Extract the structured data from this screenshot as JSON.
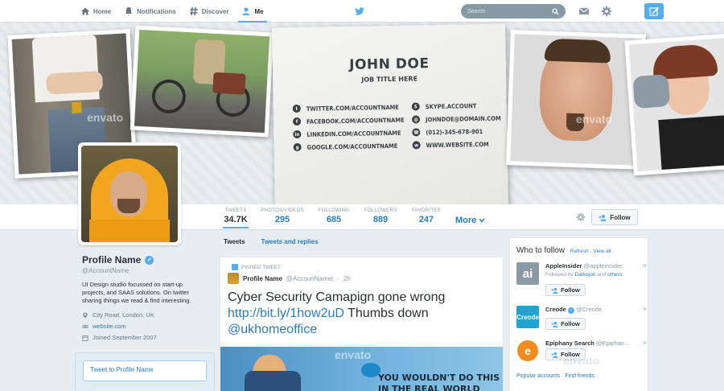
{
  "nav": {
    "home": "Home",
    "notifications": "Notifications",
    "discover": "Discover",
    "me": "Me",
    "search_placeholder": "Search"
  },
  "card": {
    "name": "JOHN DOE",
    "job": "JOB TITLE HERE",
    "contacts_left": [
      "TWITTER.COM/ACCOUNTNAME",
      "FACEBOOK.COM/ACCOUNTNAME",
      "LINKEDIN.COM/ACCOUNTNAME",
      "GOOGLE.COM/ACCOUNTNAME"
    ],
    "contacts_right": [
      "SKYPE.ACCOUNT",
      "JOHNDOE@DOMAIN.COM",
      "(012)-345-678-901",
      "WWW.WEBSITE.COM"
    ]
  },
  "stats": [
    {
      "label": "TWEETS",
      "value": "34.7K"
    },
    {
      "label": "PHOTOS/VIDEOS",
      "value": "295"
    },
    {
      "label": "FOLLOWING",
      "value": "685"
    },
    {
      "label": "FOLLOWERS",
      "value": "889"
    },
    {
      "label": "FAVORITES",
      "value": "247"
    }
  ],
  "more_label": "More",
  "follow_label": "Follow",
  "profile": {
    "name": "Profile Name",
    "handle": "@AccountName",
    "bio": "UI Design studio focussed on start-up projects, and SAAS solutions. On twitter sharing things we read & find interesting.",
    "location": "City Road, London, UK",
    "website": "website.com",
    "joined": "Joined September 2007",
    "tweet_to": "Tweet to Profile Name"
  },
  "tabs": {
    "tweets": "Tweets",
    "replies": "Tweets and replies"
  },
  "pinned_tweet": {
    "label": "PINNED TWEET",
    "author": "Profile Name",
    "handle": "@AccounNamet",
    "time": "2h",
    "text_1": "Cyber Security Camapign gone wrong",
    "link": "http://bit.ly/1how2uD",
    "text_2": "Thumbs down",
    "mention": "@ukhomeoffice",
    "media_text": "YOU WOULDN'T DO THIS IN THE REAL WORLD"
  },
  "who_to_follow": {
    "title": "Who to follow",
    "refresh": "Refresh",
    "view_all": "View all",
    "items": [
      {
        "name": "AppleInsider",
        "handle": "@appleinsider",
        "followed_prefix": "Followed by",
        "followed_by": "Darkejon",
        "and_text": "and",
        "others": "others",
        "follow": "Follow",
        "logo": "ai"
      },
      {
        "name": "Creode",
        "handle": "@Creode",
        "follow": "Follow",
        "logo": "Creode"
      },
      {
        "name": "Epiphany Search",
        "handle": "@Epiphan...",
        "follow": "Follow",
        "logo": "e"
      }
    ],
    "popular": "Popular accounts",
    "find_friends": "Find friends"
  },
  "watermark": "envato",
  "colors": {
    "accent": "#55acee",
    "link": "#2b7bb9",
    "creode": "#1fa5cf",
    "epiphany": "#f28c1c"
  }
}
